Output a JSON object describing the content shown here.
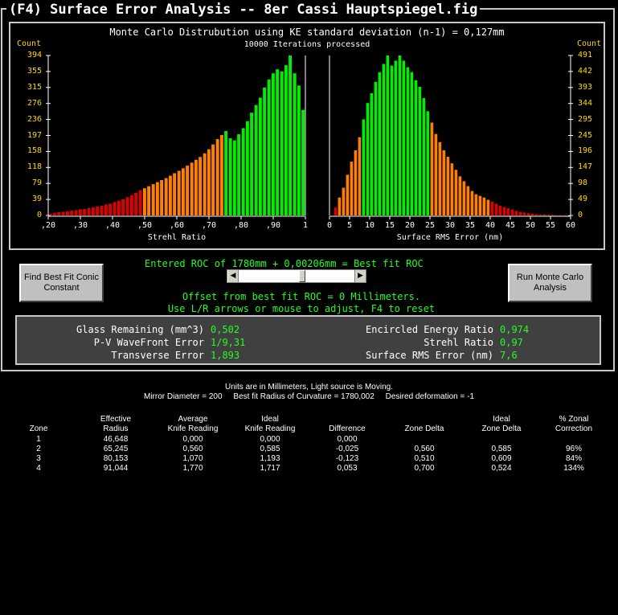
{
  "window": {
    "title": "(F4) Surface Error Analysis -- 8er Cassi Hauptspiegel.fig"
  },
  "chart_header": {
    "title": "Monte Carlo Distrubution using KE standard deviation (n-1) = 0,127mm",
    "iterations": "10000 Iterations processed"
  },
  "chart_data": [
    {
      "type": "bar",
      "xlabel": "Strehl Ratio",
      "ylabel": "Count",
      "ylim": [
        0,
        394
      ],
      "xlim": [
        0.2,
        1.0
      ],
      "ytick_labels": [
        "394",
        "355",
        "315",
        "276",
        "236",
        "197",
        "158",
        "118",
        "79",
        "39",
        "0"
      ],
      "xtick_labels": [
        ",20",
        ",30",
        ",40",
        ",50",
        ",60",
        ",70",
        ",80",
        ",90",
        "1"
      ],
      "bin_width": 0.0133,
      "colors": {
        "low": "#dd0000",
        "mid": "#ff8000",
        "high": "#00ee00"
      },
      "color_thresholds": [
        0.5,
        0.75
      ],
      "x": [
        0.207,
        0.22,
        0.233,
        0.247,
        0.26,
        0.273,
        0.287,
        0.3,
        0.313,
        0.327,
        0.34,
        0.353,
        0.367,
        0.38,
        0.393,
        0.407,
        0.42,
        0.433,
        0.447,
        0.46,
        0.473,
        0.487,
        0.5,
        0.513,
        0.527,
        0.54,
        0.553,
        0.567,
        0.58,
        0.593,
        0.607,
        0.62,
        0.633,
        0.647,
        0.66,
        0.673,
        0.687,
        0.7,
        0.713,
        0.727,
        0.74,
        0.753,
        0.767,
        0.78,
        0.793,
        0.807,
        0.82,
        0.833,
        0.847,
        0.86,
        0.873,
        0.887,
        0.9,
        0.913,
        0.927,
        0.94,
        0.953,
        0.967,
        0.98,
        0.993
      ],
      "values": [
        4,
        6,
        8,
        9,
        10,
        12,
        13,
        15,
        16,
        18,
        20,
        22,
        24,
        27,
        29,
        33,
        36,
        40,
        45,
        50,
        56,
        62,
        67,
        72,
        77,
        82,
        87,
        92,
        98,
        104,
        110,
        116,
        123,
        130,
        137,
        144,
        153,
        163,
        175,
        188,
        198,
        208,
        190,
        185,
        200,
        215,
        232,
        253,
        272,
        290,
        315,
        335,
        350,
        360,
        355,
        370,
        394,
        350,
        320,
        260
      ]
    },
    {
      "type": "bar",
      "xlabel": "Surface RMS Error (nm)",
      "ylabel": "Count",
      "ylim": [
        0,
        491
      ],
      "xlim": [
        0,
        60
      ],
      "ytick_labels": [
        "491",
        "442",
        "393",
        "344",
        "295",
        "245",
        "196",
        "147",
        "98",
        "49",
        "0"
      ],
      "xtick_labels": [
        "0",
        "5",
        "10",
        "15",
        "20",
        "25",
        "30",
        "35",
        "40",
        "45",
        "50",
        "55",
        "60"
      ],
      "bin_width": 1,
      "colors": {
        "low": "#dd0000",
        "mid": "#ff8000",
        "high": "#00ee00"
      },
      "color_thresholds_low": [
        2,
        8,
        25,
        40
      ],
      "x": [
        1.5,
        2.5,
        3.5,
        4.5,
        5.5,
        6.5,
        7.5,
        8.5,
        9.5,
        10.5,
        11.5,
        12.5,
        13.5,
        14.5,
        15.5,
        16.5,
        17.5,
        18.5,
        19.5,
        20.5,
        21.5,
        22.5,
        23.5,
        24.5,
        25.5,
        26.5,
        27.5,
        28.5,
        29.5,
        30.5,
        31.5,
        32.5,
        33.5,
        34.5,
        35.5,
        36.5,
        37.5,
        38.5,
        39.5,
        40.5,
        41.5,
        42.5,
        43.5,
        44.5,
        45.5,
        46.5,
        47.5,
        48.5,
        49.5,
        50.5,
        51.5,
        52.5,
        53.5,
        54.5,
        55.5,
        56.5,
        57.5,
        58.5,
        59.5
      ],
      "values": [
        25,
        55,
        85,
        125,
        165,
        200,
        240,
        295,
        345,
        375,
        410,
        440,
        465,
        491,
        460,
        475,
        491,
        475,
        455,
        440,
        415,
        395,
        360,
        320,
        285,
        250,
        225,
        200,
        180,
        160,
        140,
        120,
        105,
        90,
        75,
        65,
        60,
        55,
        48,
        42,
        36,
        30,
        26,
        22,
        18,
        14,
        11,
        9,
        7,
        5,
        4,
        3,
        3,
        2,
        2,
        1,
        1,
        1,
        1
      ]
    }
  ],
  "controls": {
    "best_fit_button": "Find Best Fit Conic Constant",
    "monte_carlo_button": "Run Monte Carlo Analysis",
    "roc_text": "Entered ROC of 1780mm + 0,00206mm = Best fit ROC",
    "offset_text": "Offset from best fit ROC = 0 Millimeters.",
    "adjust_text": "Use L/R arrows or mouse to adjust, F4 to reset",
    "slider_position_fraction": 0.55
  },
  "stats": {
    "glass_label": "Glass Remaining (mm^3)",
    "glass_value": "0,502",
    "pv_label": "P-V WaveFront Error",
    "pv_value": "1/9,31",
    "transverse_label": "Transverse Error",
    "transverse_value": "1,893",
    "encircled_label": "Encircled Energy Ratio",
    "encircled_value": "0,974",
    "strehl_label": "Strehl Ratio",
    "strehl_value": "0,97",
    "rms_label": "Surface RMS Error (nm)",
    "rms_value": "7,6"
  },
  "report": {
    "units_line": "Units are in Millimeters, Light source is Moving.",
    "mirror_line": "Mirror Diameter = 200     Best fit Radius of Curvature = 1780,002     Desired deformation = -1",
    "headers": [
      [
        "",
        "Zone"
      ],
      [
        "Effective",
        "Radius"
      ],
      [
        "Average",
        "Knife Reading"
      ],
      [
        "Ideal",
        "Knife Reading"
      ],
      [
        "",
        "Difference"
      ],
      [
        "",
        "Zone Delta"
      ],
      [
        "Ideal",
        "Zone Delta"
      ],
      [
        "% Zonal",
        "Correction"
      ]
    ],
    "rows": [
      [
        "1",
        "46,648",
        "0,000",
        "0,000",
        "0,000",
        "",
        "",
        ""
      ],
      [
        "2",
        "65,245",
        "0,560",
        "0,585",
        "-0,025",
        "0,560",
        "0,585",
        "96%"
      ],
      [
        "3",
        "80,153",
        "1,070",
        "1,193",
        "-0,123",
        "0,510",
        "0,609",
        "84%"
      ],
      [
        "4",
        "91,044",
        "1,770",
        "1,717",
        "0,053",
        "0,700",
        "0,524",
        "134%"
      ]
    ]
  }
}
